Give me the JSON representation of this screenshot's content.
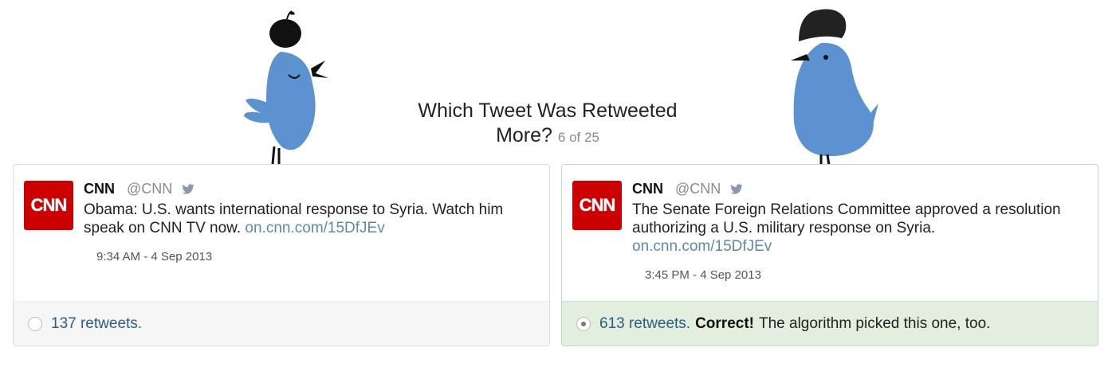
{
  "header": {
    "title_line1": "Which Tweet Was Retweeted",
    "title_line2": "More?",
    "counter": "6 of 25"
  },
  "tweets": [
    {
      "avatar_text": "CNN",
      "name": "CNN",
      "handle": "@CNN",
      "text": "Obama: U.S. wants international response to Syria. Watch him speak on CNN TV now. ",
      "link": "on.cnn.com/15DfJEv",
      "time": "9:34 AM - 4 Sep 2013",
      "retweets": "137 retweets.",
      "selected": false,
      "result": "",
      "note": ""
    },
    {
      "avatar_text": "CNN",
      "name": "CNN",
      "handle": "@CNN",
      "text": "The Senate Foreign Relations Committee approved a resolution authorizing a U.S. military response on Syria. ",
      "link": "on.cnn.com/15DfJEv",
      "time": "3:45 PM - 4 Sep 2013",
      "retweets": "613 retweets.",
      "selected": true,
      "result": "Correct!",
      "note": "The algorithm picked this one, too."
    }
  ],
  "colors": {
    "cnn_red": "#cc0000",
    "link": "#5d8aa8",
    "retweets": "#2c5d86",
    "correct_bg": "#e2efdf",
    "bird_blue": "#5b92cf"
  },
  "icons": {
    "tweet_icon": "twitter-bird-icon",
    "decor_left": "bird-with-apple-illustration",
    "decor_right": "bird-with-hat-illustration"
  }
}
